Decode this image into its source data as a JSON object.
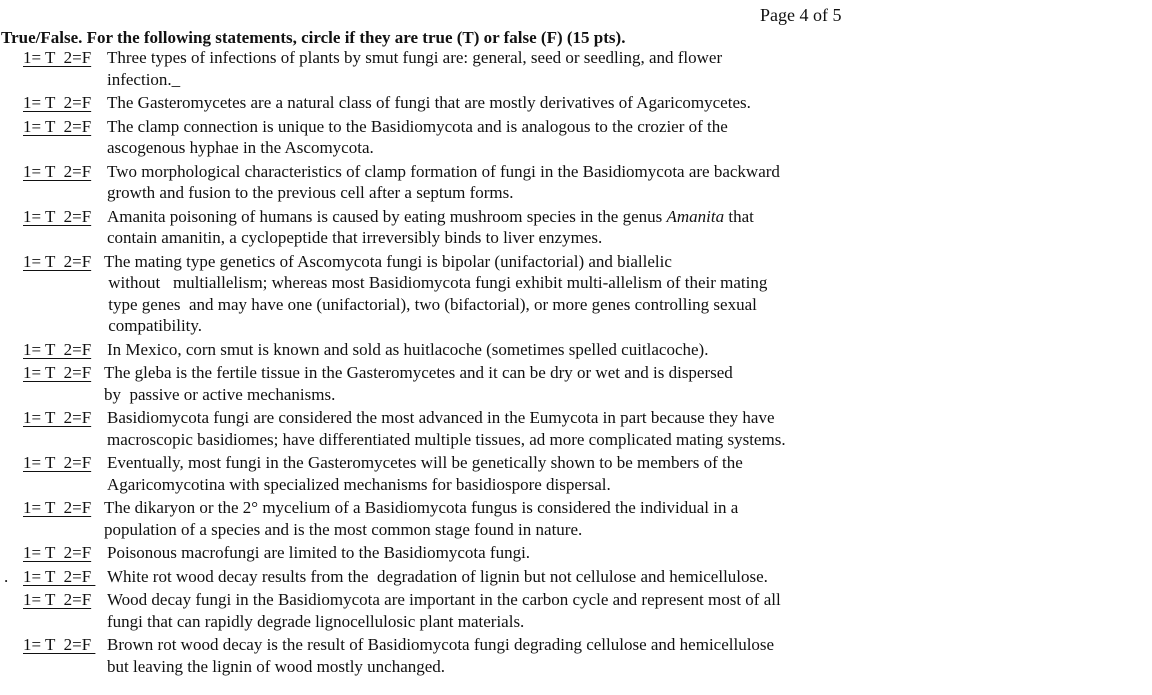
{
  "page": {
    "label": "Page 4 of 5"
  },
  "section": {
    "instructions": "True/False. For the following statements, circle if they are true (T) or false (F) (15 pts)."
  },
  "answer_key_label": "1= T  2=F",
  "items": [
    {
      "marker": "",
      "answer": "1= T  2=F",
      "lines": [
        "Three types of infections of plants by smut fungi are: general, seed or seedling, and flower",
        "infection._"
      ]
    },
    {
      "marker": "",
      "answer": "1= T  2=F",
      "lines": [
        "The Gasteromycetes are a natural class of fungi that are mostly derivatives of Agaricomycetes."
      ]
    },
    {
      "marker": "",
      "answer": "1= T  2=F",
      "lines": [
        "The clamp connection is unique to the Basidiomycota and is analogous to the crozier of the",
        "ascogenous hyphae in the Ascomycota."
      ]
    },
    {
      "marker": "",
      "answer": "1= T  2=F",
      "lines": [
        "Two morphological characteristics of clamp formation of fungi in the Basidiomycota are backward",
        "growth and fusion to the previous cell after a septum forms."
      ]
    },
    {
      "marker": "",
      "answer": "1= T  2=F",
      "lines": [
        "Amanita poisoning of humans is caused by eating mushroom species in the genus ",
        "contain amanitin, a cyclopeptide that irreversibly binds to liver enzymes."
      ],
      "italic_word": "Amanita",
      "italic_after": " that"
    },
    {
      "marker": "",
      "answer": "1= T  2=F",
      "lines": [
        "The mating type genetics of Ascomycota fungi is bipolar (unifactorial) and biallelic",
        " without   multiallelism; whereas most Basidiomycota fungi exhibit multi-allelism of their mating",
        " type genes  and may have one (unifactorial), two (bifactorial), or more genes controlling sexual",
        " compatibility."
      ],
      "tight": true
    },
    {
      "marker": "",
      "answer": "1= T  2=F",
      "lines": [
        "In Mexico, corn smut is known and sold as huitlacoche (sometimes spelled cuitlacoche)."
      ]
    },
    {
      "marker": "",
      "answer": "1= T  2=F",
      "lines": [
        "The gleba is the fertile tissue in the Gasteromycetes and it can be dry or wet and is dispersed",
        "by  passive or active mechanisms."
      ],
      "tight": true
    },
    {
      "marker": "",
      "answer": "1= T  2=F",
      "lines": [
        "Basidiomycota fungi are considered the most advanced in the Eumycota in part because they have",
        "macroscopic basidiomes; have differentiated multiple tissues, ad more complicated mating systems."
      ]
    },
    {
      "marker": "",
      "answer": "1= T  2=F",
      "lines": [
        "Eventually, most fungi in the Gasteromycetes will be genetically shown to be members of the",
        "Agaricomycotina with specialized mechanisms for basidiospore dispersal."
      ]
    },
    {
      "marker": "",
      "answer": "1= T  2=F",
      "lines": [
        "The dikaryon or the 2° mycelium of a Basidiomycota fungus is considered the individual in a",
        "population of a species and is the most common stage found in nature."
      ],
      "tight": true
    },
    {
      "marker": "",
      "answer": "1= T  2=F",
      "lines": [
        "Poisonous macrofungi are limited to the Basidiomycota fungi."
      ]
    },
    {
      "marker": ".",
      "answer": "1= T  2=F ",
      "lines": [
        "White rot wood decay results from the  degradation of lignin but not cellulose and hemicellulose."
      ]
    },
    {
      "marker": "",
      "answer": "1= T  2=F",
      "lines": [
        "Wood decay fungi in the Basidiomycota are important in the carbon cycle and represent most of all",
        "fungi that can rapidly degrade lignocellulosic plant materials."
      ]
    },
    {
      "marker": "",
      "answer": "1= T  2=F ",
      "lines": [
        "Brown rot wood decay is the result of Basidiomycota fungi degrading cellulose and hemicellulose",
        "but leaving the lignin of wood mostly unchanged."
      ]
    }
  ]
}
